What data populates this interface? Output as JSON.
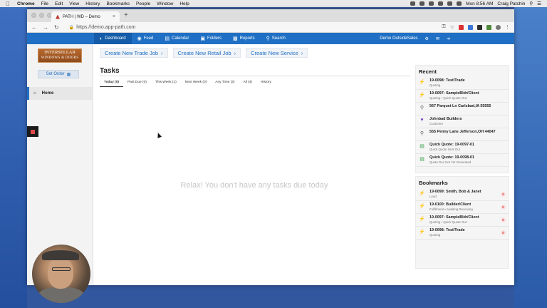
{
  "mac_menubar": {
    "app": "Chrome",
    "menus": [
      "File",
      "Edit",
      "View",
      "History",
      "Bookmarks",
      "People",
      "Window",
      "Help"
    ],
    "clock": "Mon 8:56 AM",
    "user": "Craig Patchin"
  },
  "browser": {
    "tab_title": "PATH | WD – Demo",
    "url": "https://demo.app-path.com"
  },
  "appnav": {
    "items": [
      {
        "label": "Dashboard",
        "icon": "dashboard-icon"
      },
      {
        "label": "Feed",
        "icon": "globe-icon"
      },
      {
        "label": "Calendar",
        "icon": "calendar-icon"
      },
      {
        "label": "Folders",
        "icon": "folder-icon"
      },
      {
        "label": "Reports",
        "icon": "bar-chart-icon"
      },
      {
        "label": "Search",
        "icon": "search-icon"
      }
    ],
    "account": "Demo OutsideSales"
  },
  "sidebar": {
    "logo_line1": "INTERSELLAR",
    "logo_line2": "WINDOWS & DOORS",
    "set_order": "Set Order",
    "home": "Home"
  },
  "main": {
    "create_buttons": [
      "Create New Trade Job",
      "Create New Retail Job",
      "Create New Service"
    ],
    "tasks_title": "Tasks",
    "task_tabs": [
      "Today (0)",
      "Past Due (0)",
      "This Week (1)",
      "Next Week (0)",
      "Any Time (3)",
      "All (4)",
      "History"
    ],
    "empty_message": "Relax! You don't have any tasks due today"
  },
  "recent": {
    "title": "Recent",
    "items": [
      {
        "icon": "bolt-icon",
        "title": "19-0098: Test/Trade",
        "sub": "Quoting"
      },
      {
        "icon": "bolt-icon",
        "title": "19-0097: SampleBldr/Client",
        "sub": "Quoting • Quick Quote Out"
      },
      {
        "icon": "pin-icon",
        "title": "567 Parquet Ln Carlsbad,IA 55555",
        "sub": ""
      },
      {
        "icon": "heart-icon",
        "title": "Johnbad Builders",
        "sub": "Customer"
      },
      {
        "icon": "pin-icon",
        "title": "555 Penny Lane Jefferson,OH 44047",
        "sub": ""
      },
      {
        "icon": "doc-icon",
        "title": "Quick Quote: 19-0097-01",
        "sub": "Quick Quote Sent Out"
      },
      {
        "icon": "doc-icon",
        "title": "Quick Quote: 19-0098-01",
        "sub": "Quote Doc Not Yet Generated"
      }
    ]
  },
  "bookmarks": {
    "title": "Bookmarks",
    "items": [
      {
        "icon": "bolt-icon",
        "title": "19-0099: Smith, Bob & Janet",
        "sub": "Lead"
      },
      {
        "icon": "bolt-icon",
        "title": "19-0100: Builder/Client",
        "sub": "Fulfillment • Awaiting Receiving"
      },
      {
        "icon": "bolt-icon",
        "title": "19-0097: SampleBldr/Client",
        "sub": "Quoting • Quick Quote Out"
      },
      {
        "icon": "bolt-icon",
        "title": "19-0098: Test/Trade",
        "sub": "Quoting"
      }
    ]
  },
  "colors": {
    "nav_blue": "#1f70c5",
    "link_blue": "#1f70c5",
    "bolt_orange": "#f08c1e"
  }
}
